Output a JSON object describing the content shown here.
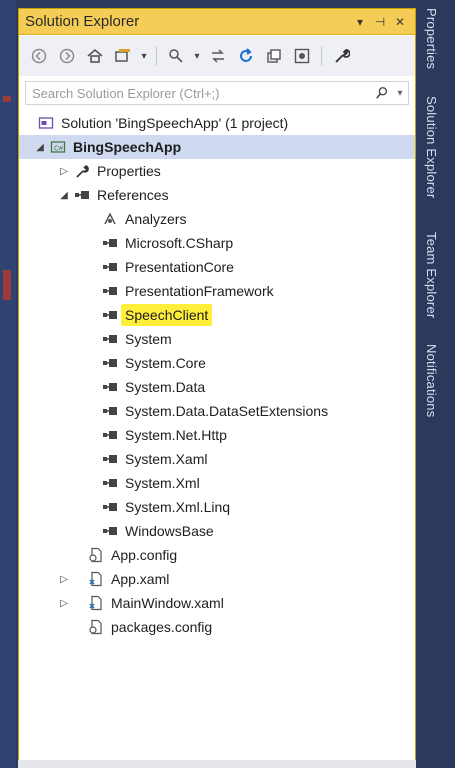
{
  "window": {
    "title": "Solution Explorer"
  },
  "titlebar_buttons": [
    {
      "name": "dropdown-icon",
      "glyph": "▾"
    },
    {
      "name": "pin-icon",
      "glyph": "⊣"
    },
    {
      "name": "close-icon",
      "glyph": "✕"
    }
  ],
  "search": {
    "placeholder": "Search Solution Explorer (Ctrl+;)"
  },
  "tree": {
    "solution": "Solution 'BingSpeechApp' (1 project)",
    "project": "BingSpeechApp",
    "properties": "Properties",
    "references": "References",
    "reference_items": [
      "Analyzers",
      "Microsoft.CSharp",
      "PresentationCore",
      "PresentationFramework",
      "SpeechClient",
      "System",
      "System.Core",
      "System.Data",
      "System.Data.DataSetExtensions",
      "System.Net.Http",
      "System.Xaml",
      "System.Xml",
      "System.Xml.Linq",
      "WindowsBase"
    ],
    "files": [
      "App.config",
      "App.xaml",
      "MainWindow.xaml",
      "packages.config"
    ]
  },
  "right_tabs": [
    "Properties",
    "Solution Explorer",
    "Team Explorer",
    "Notifications"
  ],
  "colors": {
    "titlebar": "#f5cc55",
    "highlight": "#ffee3a",
    "frame": "#2b3a5c"
  }
}
